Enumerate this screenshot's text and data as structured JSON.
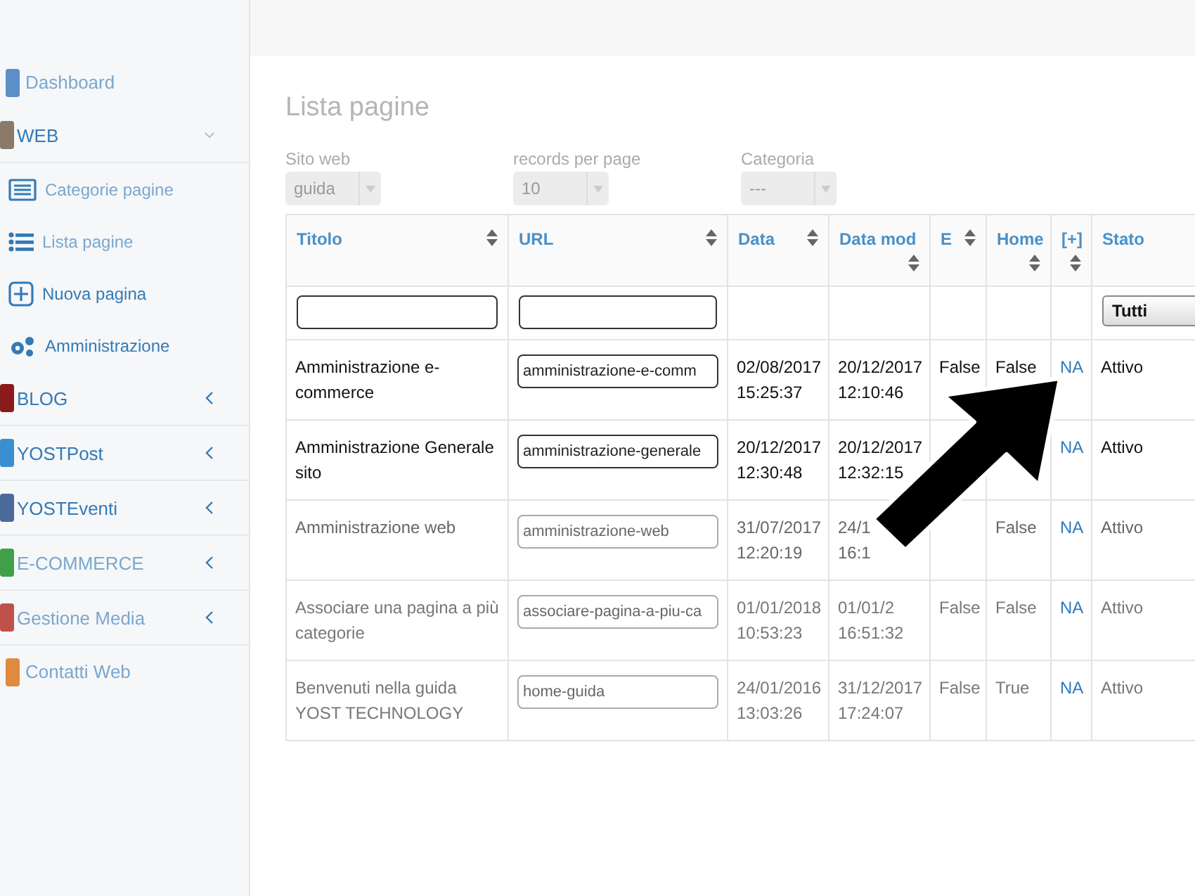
{
  "sidebar": {
    "items": [
      {
        "label": "Dashboard",
        "kind": "link",
        "color": "#5b8fc7"
      },
      {
        "label": "WEB",
        "kind": "section",
        "color": "#8a7a6a",
        "expanded": true,
        "children": [
          {
            "label": "Categorie pagine"
          },
          {
            "label": "Lista pagine"
          },
          {
            "label": "Nuova pagina"
          },
          {
            "label": "Amministrazione"
          }
        ]
      },
      {
        "label": "BLOG",
        "kind": "section",
        "color": "#8b1a1a",
        "expanded": false
      },
      {
        "label": "YOSTPost",
        "kind": "section",
        "color": "#3a8fd0",
        "expanded": false
      },
      {
        "label": "YOSTEventi",
        "kind": "section",
        "color": "#4a6a9a",
        "expanded": false
      },
      {
        "label": "E-COMMERCE",
        "kind": "section",
        "color": "#3fa04a",
        "expanded": false
      },
      {
        "label": "Gestione Media",
        "kind": "section",
        "color": "#c0504a",
        "expanded": false
      },
      {
        "label": "Contatti Web",
        "kind": "link",
        "color": "#e08a40"
      }
    ]
  },
  "page_title": "Lista pagine",
  "filters": [
    {
      "label": "Sito web",
      "value": "guida"
    },
    {
      "label": "records per page",
      "value": "10"
    },
    {
      "label": "Categoria",
      "value": "---"
    }
  ],
  "table": {
    "columns": [
      {
        "label": "Titolo",
        "kind": "text"
      },
      {
        "label": "URL",
        "kind": "text"
      },
      {
        "label": "Data"
      },
      {
        "label": "Data mod"
      },
      {
        "label": "E"
      },
      {
        "label": "Home"
      },
      {
        "label": "[+]"
      },
      {
        "label": "Stato",
        "kind": "select",
        "value": "Tutti"
      }
    ],
    "rows": [
      {
        "titolo": "Amministrazione e-commerce",
        "url": "amministrazione-e-comm",
        "data": [
          "02/08/2017",
          "15:25:37"
        ],
        "data_mod": [
          "20/12/2017",
          "12:10:46"
        ],
        "e": "False",
        "home": "False",
        "plus": "NA",
        "stato": "Attivo"
      },
      {
        "titolo": "Amministrazione Generale sito",
        "url": "amministrazione-generale",
        "data": [
          "20/12/2017",
          "12:30:48"
        ],
        "data_mod": [
          "20/12/2017",
          "12:32:15"
        ],
        "plus": "NA",
        "stato": "Attivo"
      },
      {
        "titolo": "Amministrazione web",
        "url": "amministrazione-web",
        "data": [
          "31/07/2017",
          "12:20:19"
        ],
        "data_mod": [
          "24/1",
          "16:1"
        ],
        "home": "False",
        "plus": "NA",
        "stato": "Attivo"
      },
      {
        "titolo": "Associare una pagina a più categorie",
        "url": "associare-pagina-a-piu-ca",
        "data": [
          "01/01/2018",
          "10:53:23"
        ],
        "data_mod": [
          "01/01/2",
          "16:51:32"
        ],
        "e": "False",
        "home": "False",
        "plus": "NA",
        "stato": "Attivo"
      },
      {
        "titolo": "Benvenuti nella guida YOST TECHNOLOGY",
        "url": "home-guida",
        "data": [
          "24/01/2016",
          "13:03:26"
        ],
        "data_mod": [
          "31/12/2017",
          "17:24:07"
        ],
        "e": "False",
        "home": "True",
        "plus": "NA",
        "stato": "Attivo"
      }
    ]
  }
}
